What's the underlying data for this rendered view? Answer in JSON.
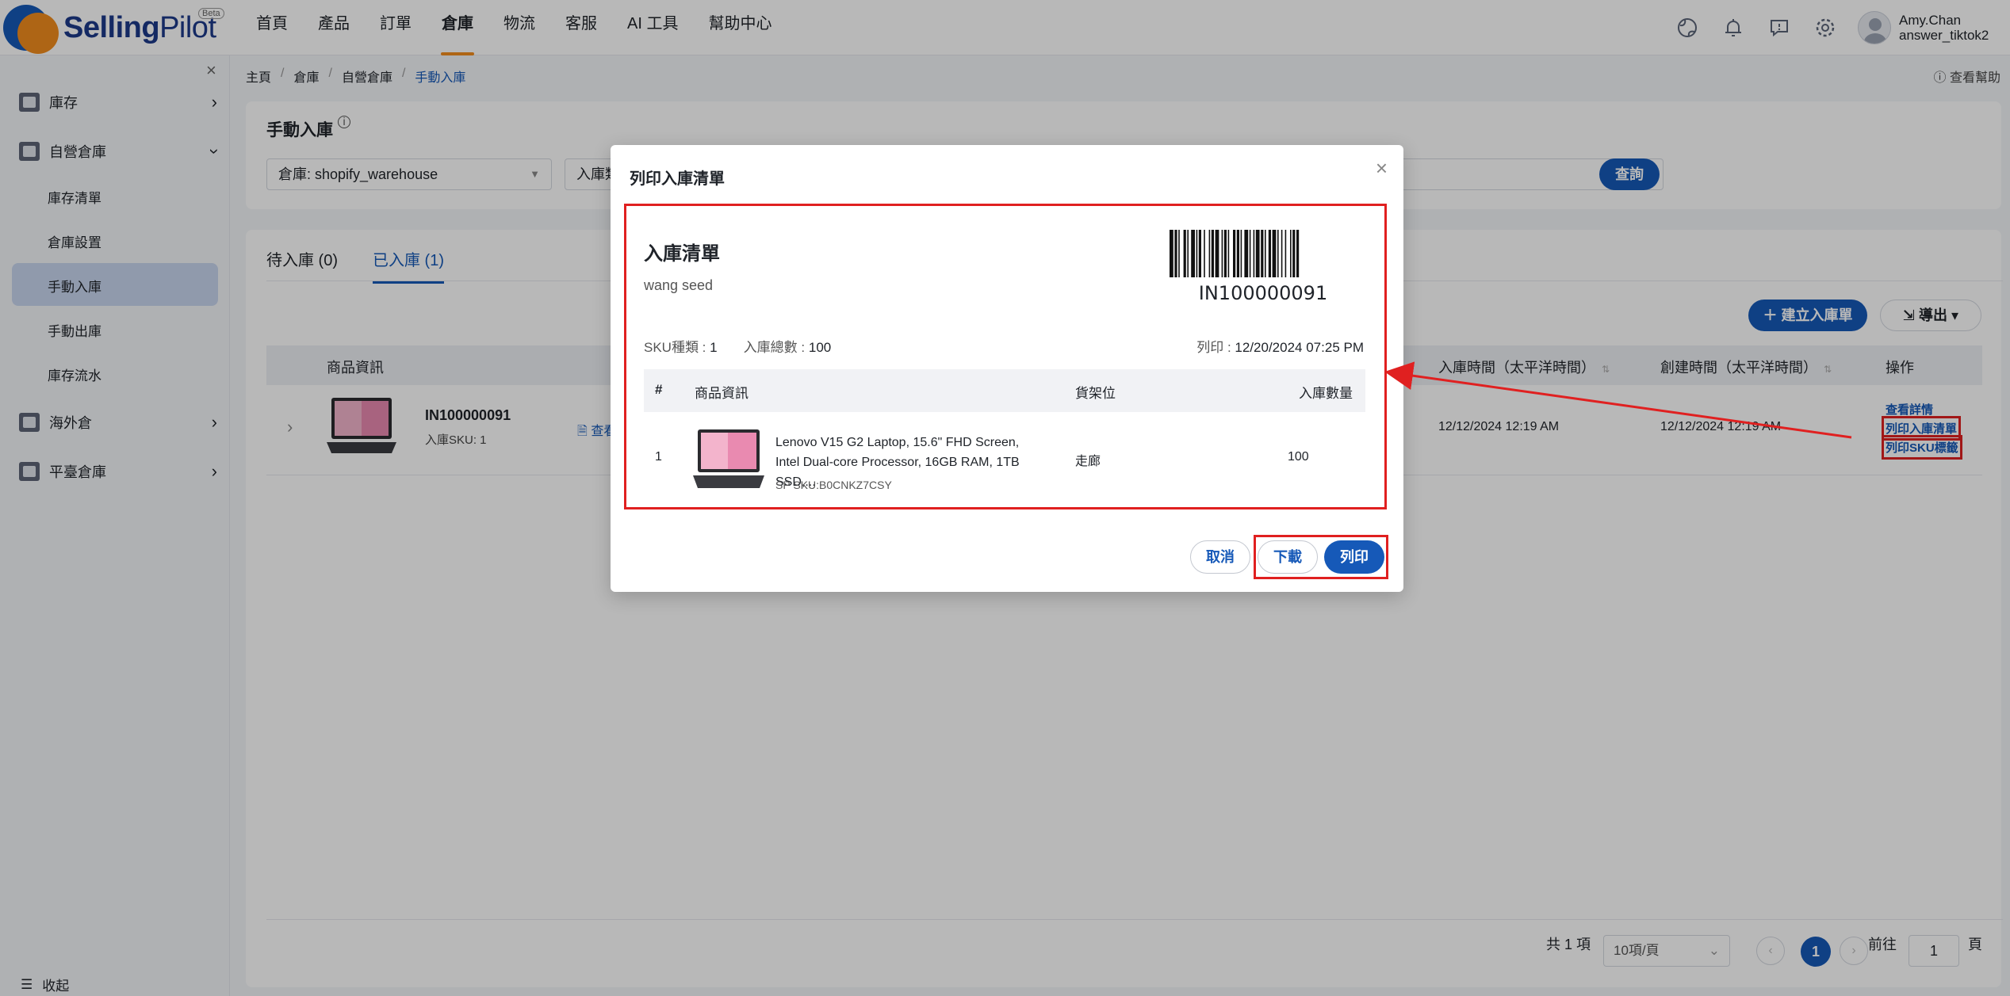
{
  "brand": {
    "name_bold": "Selling",
    "name_light": "Pilot",
    "beta": "Beta"
  },
  "nav": [
    "首頁",
    "產品",
    "訂單",
    "倉庫",
    "物流",
    "客服",
    "AI 工具",
    "幫助中心"
  ],
  "nav_active": "倉庫",
  "user": {
    "name": "Amy.Chan",
    "account": "answer_tiktok2"
  },
  "sidebar": {
    "groups": [
      {
        "label": "庫存",
        "icon": "warehouse-icon"
      },
      {
        "label": "自營倉庫",
        "icon": "self-warehouse-icon"
      },
      {
        "label": "海外倉",
        "icon": "overseas-warehouse-icon"
      },
      {
        "label": "平臺倉庫",
        "icon": "platform-warehouse-icon"
      }
    ],
    "subitems": [
      "庫存清單",
      "倉庫設置",
      "手動入庫",
      "手動出庫",
      "庫存流水"
    ],
    "active": "手動入庫",
    "collapse": "收起"
  },
  "breadcrumb": [
    "主頁",
    "倉庫",
    "自營倉庫",
    "手動入庫"
  ],
  "help": "查看幫助",
  "filter": {
    "title": "手動入庫",
    "warehouse": "倉庫: shopify_warehouse",
    "second_prefix": "入庫類",
    "query": "查詢"
  },
  "tabs": [
    {
      "label": "待入庫 (0)"
    },
    {
      "label": "已入庫 (1)"
    }
  ],
  "buttons": {
    "create": "建立入庫單",
    "export": "導出"
  },
  "table": {
    "headers": {
      "product": "商品資訊",
      "inbound_time": "入庫時間（太平洋時間）",
      "created_time": "創建時間（太平洋時間）",
      "actions": "操作"
    },
    "row": {
      "id": "IN100000091",
      "sku_count": "入庫SKU: 1",
      "link": "查看備",
      "inbound_time": "12/12/2024 12:19 AM",
      "created_time": "12/12/2024 12:19 AM",
      "actions": [
        "查看詳情",
        "列印入庫清單",
        "列印SKU標籤"
      ]
    }
  },
  "pagination": {
    "total": "共 1 項",
    "per_page": "10項/頁",
    "current": "1",
    "goto": "前往",
    "goto_value": "1",
    "page_suffix": "頁"
  },
  "modal": {
    "title": "列印入庫清單",
    "list_title": "入庫清單",
    "warehouse_name": "wang seed",
    "barcode": "IN100000091",
    "sku_types_label": "SKU種類 :",
    "sku_types": "1",
    "total_label": "入庫總數 :",
    "total": "100",
    "printed_label": "列印 :",
    "printed": "12/20/2024 07:25 PM",
    "headers": {
      "idx": "#",
      "product": "商品資訊",
      "shelf": "貨架位",
      "qty": "入庫數量"
    },
    "row": {
      "idx": "1",
      "name": "Lenovo V15 G2 Laptop, 15.6\" FHD Screen, Intel Dual-core Processor, 16GB RAM, 1TB SSD,...",
      "sp_sku": "SP SKU:B0CNKZ7CSY",
      "shelf": "走廊",
      "qty": "100"
    },
    "cancel": "取消",
    "download": "下載",
    "print": "列印"
  },
  "colors": {
    "primary": "#1659b8",
    "accent": "#f28c1e",
    "annotation": "#e02020"
  }
}
